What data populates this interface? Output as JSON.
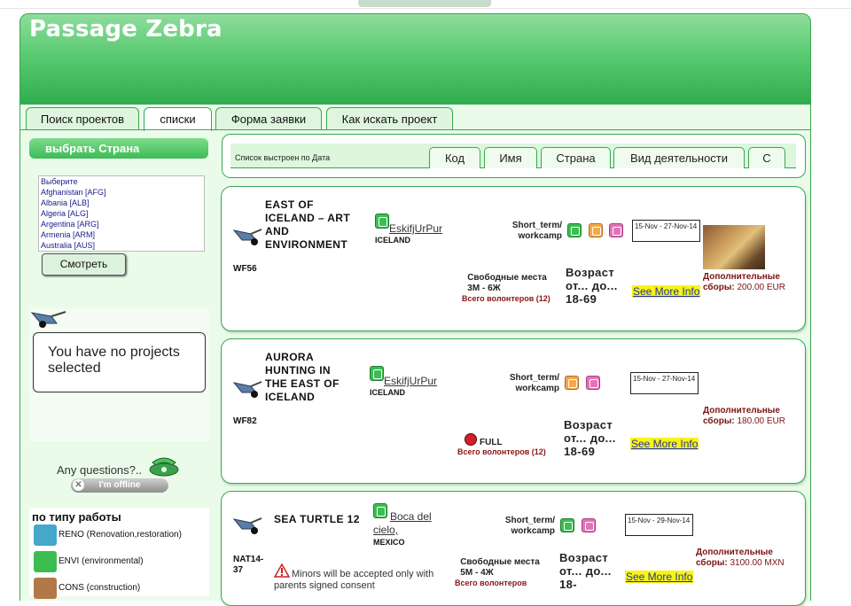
{
  "site": {
    "title": "Passage Zebra"
  },
  "tabs": [
    {
      "label": "Поиск проектов"
    },
    {
      "label": "списки"
    },
    {
      "label": "Форма заявки"
    },
    {
      "label": "Как искать проект"
    }
  ],
  "sidebar": {
    "country_header": "выбрать Страна",
    "countries": [
      "Выберите",
      "Afghanistan [AFG]",
      "Albania [ALB]",
      "Algeria [ALG]",
      "Argentina [ARG]",
      "Armenia [ARM]",
      "Australia [AUS]"
    ],
    "show_button": "Смотреть",
    "no_projects": "You have no projects selected",
    "questions": "Any questions?..",
    "offline": "I'm offline",
    "work_type_title": "по типу работы",
    "work_types": [
      {
        "text": "RENO  (Renovation,restoration)",
        "color": "#45a7c9"
      },
      {
        "text": "ENVI  (environmental)",
        "color": "#3bbd52"
      },
      {
        "text": "CONS  (construction)",
        "color": "#b2784a"
      }
    ]
  },
  "sort": {
    "label": "Список выстроен по Дата",
    "tabs": [
      "Код",
      "Имя",
      "Страна",
      "Вид деятельности",
      "С"
    ]
  },
  "projects": [
    {
      "title": "EAST OF ICELAND – ART AND ENVIRONMENT",
      "code": "WF56",
      "org": "EskifjUrPur",
      "country": "ICELAND",
      "type": "Short_term/ workcamp",
      "dates": "15-Nov - 27-Nov-14",
      "places_label": "Свободные места",
      "places": "3M - 6Ж",
      "total": "Всего волонтеров (12)",
      "age": "Возраст от... до...  18-69",
      "more": "See More Info",
      "fee_label": "Дополнительные сборы:",
      "fee": "200.00 EUR"
    },
    {
      "title": "AURORA HUNTING IN THE EAST OF ICELAND",
      "code": "WF82",
      "org": "EskifjUrPur",
      "country": "ICELAND",
      "type": "Short_term/ workcamp",
      "dates": "15-Nov - 27-Nov-14",
      "places": "FULL",
      "total": "Всего волонтеров (12)",
      "age": "Возраст от... до...  18-69",
      "more": "See More Info",
      "fee_label": "Дополнительные сборы:",
      "fee": "180.00 EUR"
    },
    {
      "title": "SEA TURTLE 12",
      "code": "NAT14-37",
      "org": "Boca del cielo,",
      "country": "MEXICO",
      "type": "Short_term/ workcamp",
      "dates": "15-Nov - 29-Nov-14",
      "places_label": "Свободные места",
      "places": "5M - 4Ж",
      "total": "Всего волонтеров",
      "age": "Возраст от... до...  18-",
      "more": "See More Info",
      "fee_label": "Дополнительные сборы:",
      "fee": "3100.00 MXN",
      "warning": "Minors will be accepted only with parents signed consent"
    }
  ]
}
